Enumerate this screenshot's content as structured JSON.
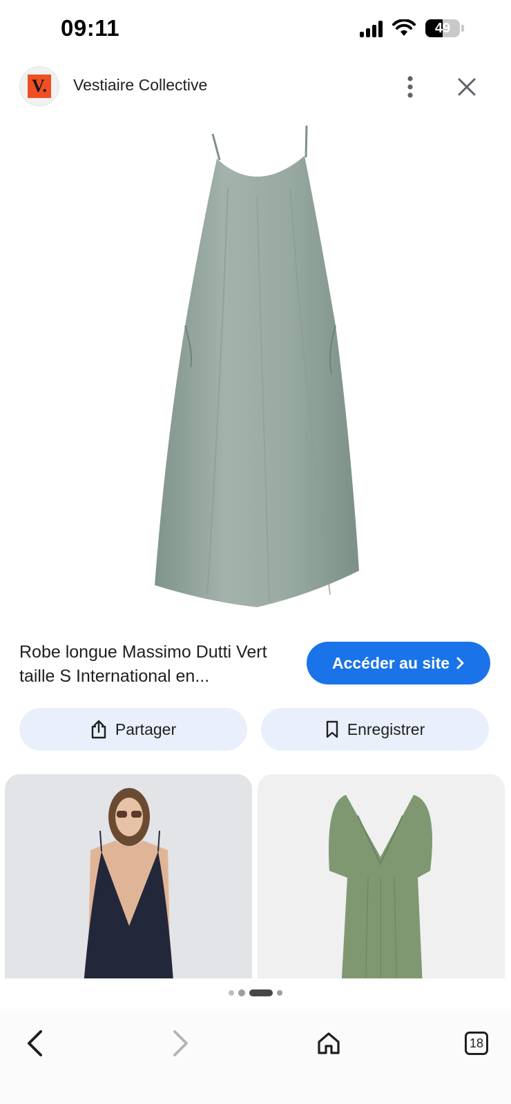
{
  "status_bar": {
    "time": "09:11",
    "battery_level": "49",
    "icons": [
      "signal-icon",
      "wifi-icon",
      "battery-icon"
    ]
  },
  "header": {
    "site_logo_text": "V.",
    "site_name": "Vestiaire Collective",
    "icons": [
      "more-vert-icon",
      "close-icon"
    ]
  },
  "main_image": {
    "subject": "sage green long slip dress",
    "color": "#8fa29a"
  },
  "product": {
    "title": "Robe longue Massimo Dutti Vert taille S International en...",
    "visit_label": "Accéder au site",
    "visit_color": "#1a73e8"
  },
  "actions": {
    "share_label": "Partager",
    "save_label": "Enregistrer",
    "button_bg": "#e9effb"
  },
  "related_images": [
    {
      "subject": "model in navy slip dress"
    },
    {
      "subject": "green v-neck dress"
    }
  ],
  "pager": {
    "count": 4,
    "active_index": 2
  },
  "bottom_nav": {
    "tab_count": "18",
    "icons": [
      "back-arrow-icon",
      "forward-arrow-icon",
      "home-icon",
      "tabs-icon"
    ]
  }
}
